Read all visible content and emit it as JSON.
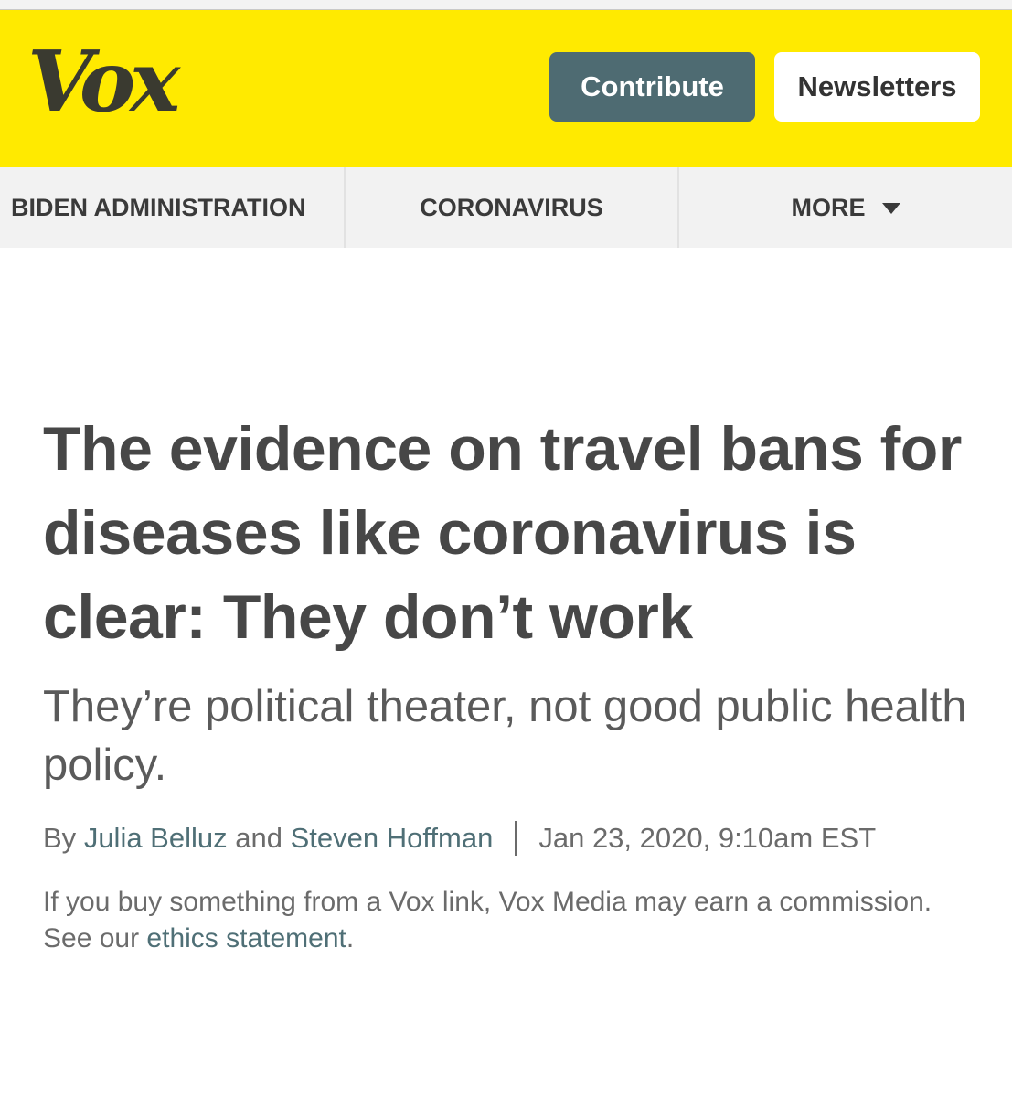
{
  "header": {
    "logo": "Vox",
    "contribute_label": "Contribute",
    "newsletters_label": "Newsletters",
    "background_color": "#ffea00",
    "contribute_color": "#4e6b72"
  },
  "nav": {
    "items": [
      {
        "label": "BIDEN ADMINISTRATION"
      },
      {
        "label": "CORONAVIRUS"
      },
      {
        "label": "MORE",
        "icon": "chevron-down-icon"
      }
    ]
  },
  "article": {
    "headline": "The evidence on travel bans for diseases like coronavirus is clear: They don’t work",
    "dek": "They’re political theater, not good public health policy.",
    "byline": {
      "prefix": "By",
      "author1": "Julia Belluz",
      "conjunction": "and",
      "author2": "Steven Hoffman",
      "date": "Jan 23, 2020, 9:10am EST"
    },
    "disclosure": {
      "text": "If you buy something from a Vox link, Vox Media may earn a commission. See our",
      "link": "ethics statement",
      "end": "."
    }
  }
}
